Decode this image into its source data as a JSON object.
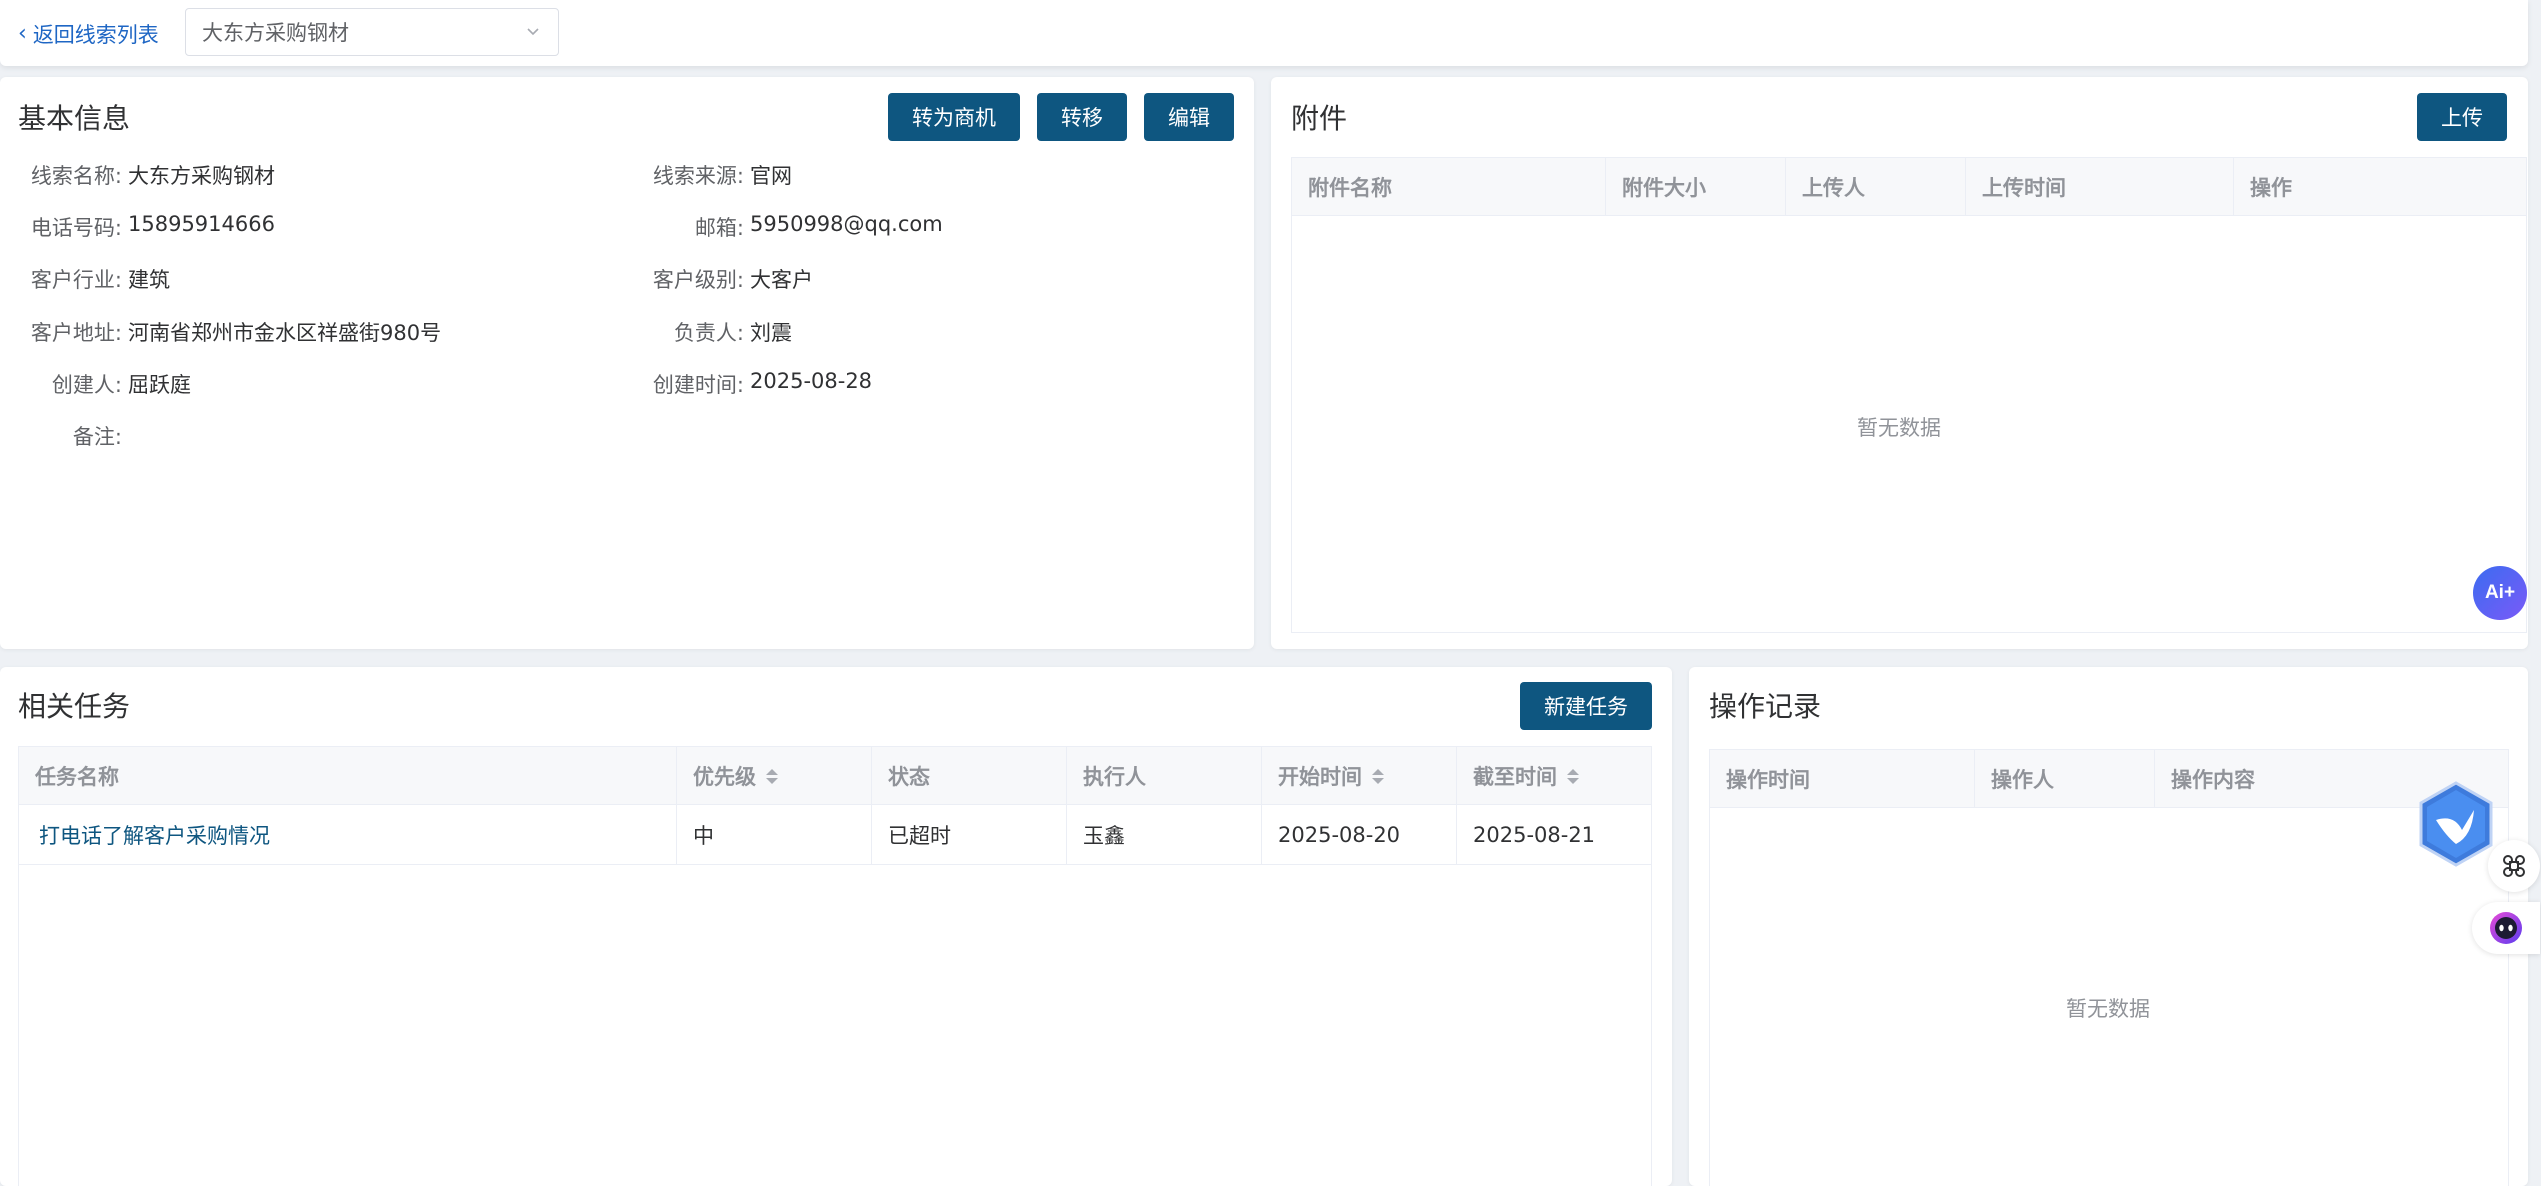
{
  "topbar": {
    "back_label": "返回线索列表",
    "selected_lead": "大东方采购钢材"
  },
  "basic_info": {
    "title": "基本信息",
    "buttons": {
      "convert": "转为商机",
      "transfer": "转移",
      "edit": "编辑"
    },
    "fields": [
      {
        "label": "线索名称:",
        "value": "大东方采购钢材"
      },
      {
        "label": "线索来源:",
        "value": "官网"
      },
      {
        "label": "电话号码:",
        "value": "15895914666"
      },
      {
        "label": "邮箱:",
        "value": "5950998@qq.com"
      },
      {
        "label": "客户行业:",
        "value": "建筑"
      },
      {
        "label": "客户级别:",
        "value": "大客户"
      },
      {
        "label": "客户地址:",
        "value": "河南省郑州市金水区祥盛街980号"
      },
      {
        "label": "负责人:",
        "value": "刘震"
      },
      {
        "label": "创建人:",
        "value": "屈跃庭"
      },
      {
        "label": "创建时间:",
        "value": "2025-08-28"
      },
      {
        "label": "备注:",
        "value": ""
      }
    ]
  },
  "attachments": {
    "title": "附件",
    "upload_label": "上传",
    "columns": [
      "附件名称",
      "附件大小",
      "上传人",
      "上传时间",
      "操作"
    ],
    "empty_text": "暂无数据"
  },
  "tasks": {
    "title": "相关任务",
    "new_label": "新建任务",
    "columns": [
      "任务名称",
      "优先级",
      "状态",
      "执行人",
      "开始时间",
      "截至时间"
    ],
    "rows": [
      {
        "name": "打电话了解客户采购情况",
        "priority": "中",
        "status": "已超时",
        "assignee": "玉鑫",
        "start": "2025-08-20",
        "end": "2025-08-21"
      }
    ]
  },
  "operation_log": {
    "title": "操作记录",
    "columns": [
      "操作时间",
      "操作人",
      "操作内容"
    ],
    "empty_text": "暂无数据"
  },
  "floating": {
    "ai_label": "Ai+"
  },
  "colors": {
    "primary": "#0e5680",
    "link": "#1e66c4",
    "background": "#eef1f5"
  }
}
